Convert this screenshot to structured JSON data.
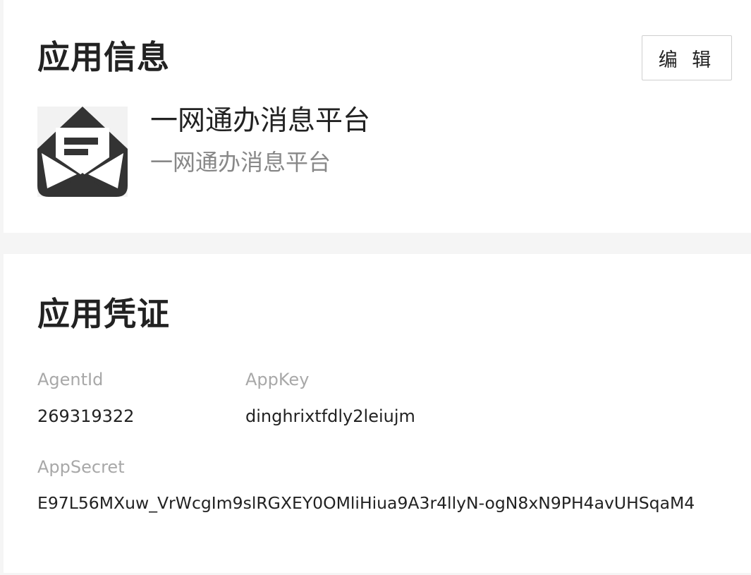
{
  "app_info": {
    "title": "应用信息",
    "edit_label": "编 辑",
    "icon": "envelope-open-icon",
    "name": "一网通办消息平台",
    "description": "一网通办消息平台"
  },
  "credentials": {
    "title": "应用凭证",
    "agent_id": {
      "label": "AgentId",
      "value": "269319322"
    },
    "app_key": {
      "label": "AppKey",
      "value": "dinghrixtfdly2leiujm"
    },
    "app_secret": {
      "label": "AppSecret",
      "value": "E97L56MXuw_VrWcgIm9slRGXEY0OMliHiua9A3r4llyN-ogN8xN9PH4avUHSqaM4"
    }
  },
  "colors": {
    "page_background": "#f5f5f5",
    "card_background": "#ffffff",
    "icon_color": "#333333",
    "muted_text": "#a8a8a8"
  }
}
